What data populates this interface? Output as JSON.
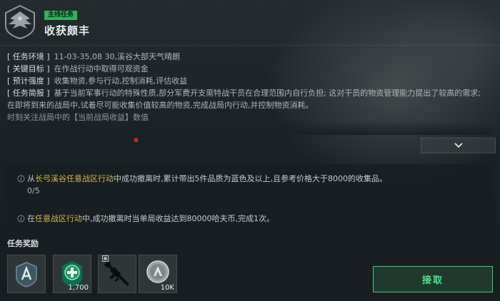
{
  "header": {
    "tag": "主线任务",
    "title": "收获颇丰"
  },
  "info": {
    "env_label": "[ 任务环境 ]",
    "env_value": "11-03-35,08 30,溪谷大部天气晴朗",
    "goal_label": "[ 关键目标 ]",
    "goal_value": "在作战行动中取得可观资金",
    "intensity_label": "[ 预计强度 ]",
    "intensity_value": "收集物资,参与行动,控制消耗,评估收益",
    "brief_label": "[ 任务简报 ]",
    "brief_value": "基于当前军事行动的特殊性质,部分军费开支需特战干员在合理范围内自行负担; 这对干员的物资管理能力提出了较高的需求;",
    "brief_line2": "在即将到来的战局中,试着尽可能收集价值较高的物资,完成战局内行动,并控制物资消耗。",
    "brief_line3": "时刻关注战局中的【当前战局收益】数值"
  },
  "tasks": [
    {
      "pre": "从",
      "highlight": "长弓溪谷任意战区行动",
      "post": "中成功撤离时,累计带出5件品质为蓝色及以上,且参考价格大于8000的收集品。",
      "progress": "0/5"
    },
    {
      "pre": "在",
      "highlight": "任意战区行动",
      "post": "中,成功撤离时当单局收益达到80000哈夫币,完成1次。"
    }
  ],
  "rewards": {
    "title": "任务奖励",
    "items": [
      {
        "icon": "faction-badge-icon",
        "count": ""
      },
      {
        "icon": "medical-case-icon",
        "count": "1,700"
      },
      {
        "icon": "rifle-icon",
        "count": ""
      },
      {
        "icon": "currency-coin-icon",
        "count": "10K"
      }
    ]
  },
  "claim_button": "接取",
  "colors": {
    "accent_green": "#3dd07a",
    "highlight_gold": "#d8b54a",
    "tag_green": "#2fb457"
  }
}
